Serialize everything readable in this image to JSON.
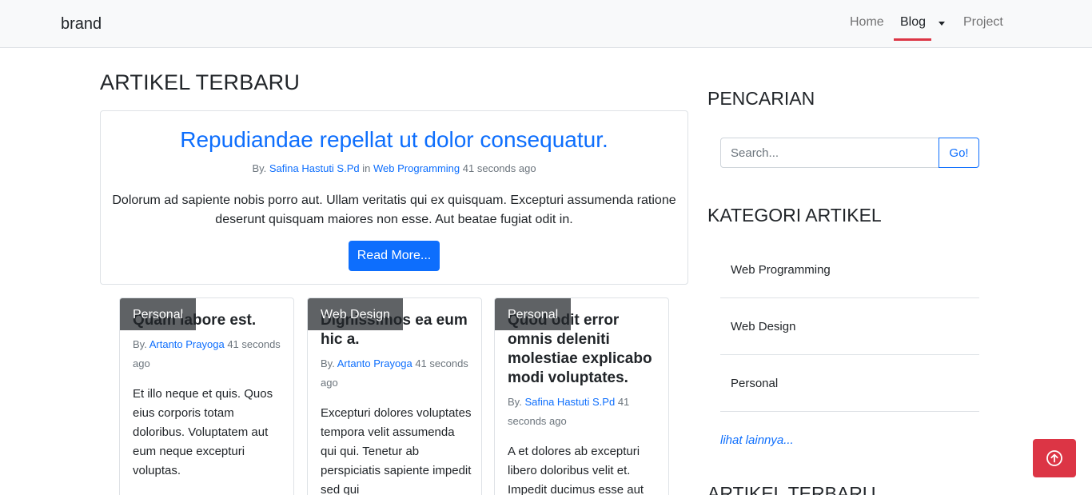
{
  "navbar": {
    "brand": "brand",
    "items": [
      "Home",
      "Blog",
      "Project"
    ],
    "active": "Blog"
  },
  "main": {
    "title": "ARTIKEL TERBARU",
    "featured": {
      "title": "Repudiandae repellat ut dolor consequatur.",
      "meta_by": "By.",
      "author": "Safina Hastuti S.Pd",
      "meta_in": "in",
      "category": "Web Programming",
      "time": "41 seconds ago",
      "excerpt": "Dolorum ad sapiente nobis porro aut. Ullam veritatis qui ex quisquam. Excepturi assumenda ratione deserunt quisquam maiores non esse. Aut beatae fugiat odit in.",
      "button_label": "Read More..."
    },
    "cards": [
      {
        "badge": "Personal",
        "title": "Quam labore est.",
        "meta_by": "By.",
        "author": "Artanto Prayoga",
        "time": "41 seconds ago",
        "excerpt": "Et illo neque et quis. Quos eius corporis totam doloribus. Voluptatem aut eum neque excepturi voluptas."
      },
      {
        "badge": "Web Design",
        "title": "Dignissimos ea eum hic a.",
        "meta_by": "By.",
        "author": "Artanto Prayoga",
        "time": "41 seconds ago",
        "excerpt": "Excepturi dolores voluptates tempora velit assumenda qui qui. Tenetur ab perspiciatis sapiente impedit sed qui"
      },
      {
        "badge": "Personal",
        "title": "Quod odit error omnis deleniti molestiae explicabo modi voluptates.",
        "meta_by": "By.",
        "author": "Safina Hastuti S.Pd",
        "time": "41 seconds ago",
        "excerpt": "A et dolores ab excepturi libero doloribus velit et. Impedit ducimus esse aut"
      }
    ]
  },
  "sidebar": {
    "search_title": "PENCARIAN",
    "search_placeholder": "Search...",
    "search_button": "Go!",
    "category_title": "KATEGORI ARTIKEL",
    "categories": [
      "Web Programming",
      "Web Design",
      "Personal"
    ],
    "more_link": "lihat lainnya...",
    "latest_title": "ARTIKEL TERBARU"
  },
  "colors": {
    "primary": "#0d6efd",
    "danger": "#dc3545",
    "navbar_bg": "#f8f9fa"
  },
  "icons": {
    "back_to_top": "arrow-up-circle-icon"
  }
}
